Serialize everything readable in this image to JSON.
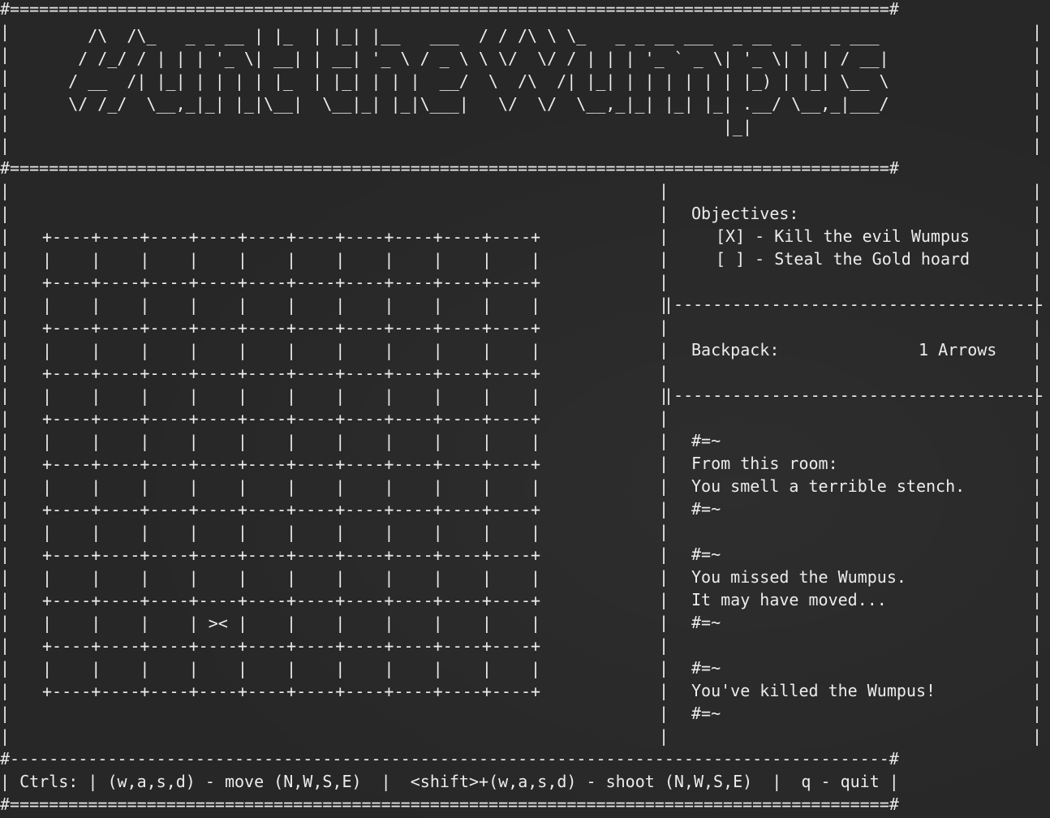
{
  "title_banner": "     /\\  /\\_   _ _ __ | |_  | |_| |__   ___  / / /\\ \\ \\_   _ _ __ ___  _ __  _   _ ___\n    / /_/ / | | | '_ \\| __| | __| '_ \\ / _ \\ \\ \\/  \\/ / | | | '_ ` _ \\| '_ \\| | | / __|\n   / __  /| |_| | | | | |_  | |_| | | |  __/  \\  /\\  /| |_| | | | | | | |_) | |_| \\__ \\\n   \\/ /_/  \\__,_|_| |_|\\__|  \\__|_| |_|\\___|   \\/  \\/  \\__,_|_| |_| |_| .__/ \\__,_|___/\n                                                                      |_|",
  "board": {
    "rows": 10,
    "cols": 10,
    "player_row": 9,
    "player_col": 4,
    "player_marker": "><"
  },
  "objectives": {
    "heading": "Objectives:",
    "items": [
      "[X] - Kill the evil Wumpus",
      "[ ] - Steal the Gold hoard"
    ]
  },
  "backpack": {
    "label": "Backpack:",
    "value": "1 Arrows"
  },
  "messages": [
    {
      "open": "#=~",
      "lines": [
        "From this room:",
        "You smell a terrible stench."
      ],
      "close": "#=~"
    },
    {
      "open": "#=~",
      "lines": [
        "You missed the Wumpus.",
        "It may have moved..."
      ],
      "close": "#=~"
    },
    {
      "open": "#=~",
      "lines": [
        "You've killed the Wumpus!"
      ],
      "close": "#=~"
    }
  ],
  "controls": {
    "label": "Ctrls:",
    "move": "(w,a,s,d) - move (N,W,S,E)",
    "shoot": "<shift>+(w,a,s,d) - shoot (N,W,S,E)",
    "quit": "q - quit"
  }
}
